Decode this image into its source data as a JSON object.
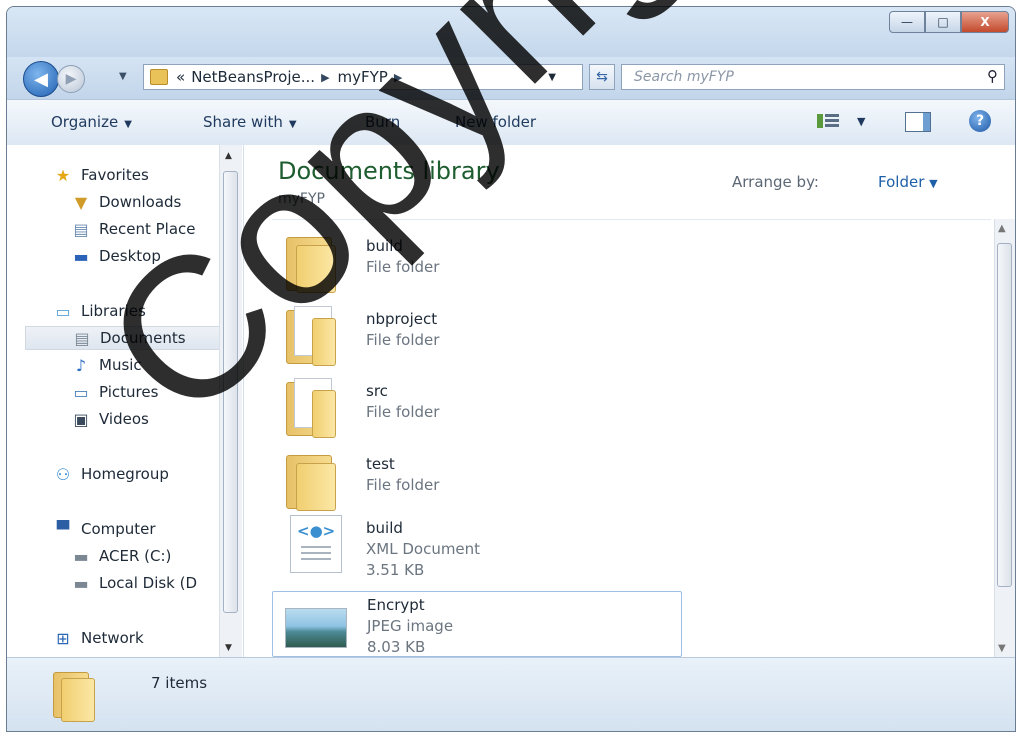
{
  "window": {
    "caption_buttons": {
      "minimize": "—",
      "maximize": "□",
      "close": "X"
    }
  },
  "navigation": {
    "breadcrumb_prefix": "«",
    "crumbs": [
      "NetBeansProje...",
      "myFYP"
    ],
    "search_placeholder": "Search myFYP"
  },
  "toolbar": {
    "organize": "Organize",
    "share_with": "Share with",
    "burn": "Burn",
    "new_folder": "New folder"
  },
  "sidebar": {
    "items": [
      {
        "label": "Favorites",
        "icon": "star-icon"
      },
      {
        "label": "Downloads",
        "icon": "downloads-icon"
      },
      {
        "label": "Recent Place",
        "icon": "recent-places-icon"
      },
      {
        "label": "Desktop",
        "icon": "desktop-icon"
      },
      {
        "label": "Libraries",
        "icon": "libraries-icon"
      },
      {
        "label": "Documents",
        "icon": "documents-icon",
        "selected": true
      },
      {
        "label": "Music",
        "icon": "music-icon"
      },
      {
        "label": "Pictures",
        "icon": "pictures-icon"
      },
      {
        "label": "Videos",
        "icon": "videos-icon"
      },
      {
        "label": "Homegroup",
        "icon": "homegroup-icon"
      },
      {
        "label": "Computer",
        "icon": "computer-icon"
      },
      {
        "label": "ACER (C:)",
        "icon": "drive-c-icon"
      },
      {
        "label": "Local Disk (D",
        "icon": "local-disk-icon"
      },
      {
        "label": "Network",
        "icon": "network-icon"
      }
    ]
  },
  "main": {
    "title": "Documents library",
    "subtitle": "myFYP",
    "arrange_label": "Arrange by:",
    "arrange_value": "Folder",
    "files": [
      {
        "name": "build",
        "type": "File folder",
        "size": "",
        "icon": "folder-icon"
      },
      {
        "name": "nbproject",
        "type": "File folder",
        "size": "",
        "icon": "folder-icon"
      },
      {
        "name": "src",
        "type": "File folder",
        "size": "",
        "icon": "folder-icon"
      },
      {
        "name": "test",
        "type": "File folder",
        "size": "",
        "icon": "folder-icon"
      },
      {
        "name": "build",
        "type": "XML Document",
        "size": "3.51 KB",
        "icon": "xml-file-icon"
      },
      {
        "name": "Encrypt",
        "type": "JPEG image",
        "size": "8.03 KB",
        "icon": "jpeg-file-icon",
        "selected": true
      }
    ]
  },
  "details": {
    "item_count": "7 items"
  },
  "watermark": "Copyright@",
  "colors": {
    "library_title": "#1e5d2f",
    "link_blue": "#1f5fa8",
    "close_button": "#c34a2d"
  }
}
